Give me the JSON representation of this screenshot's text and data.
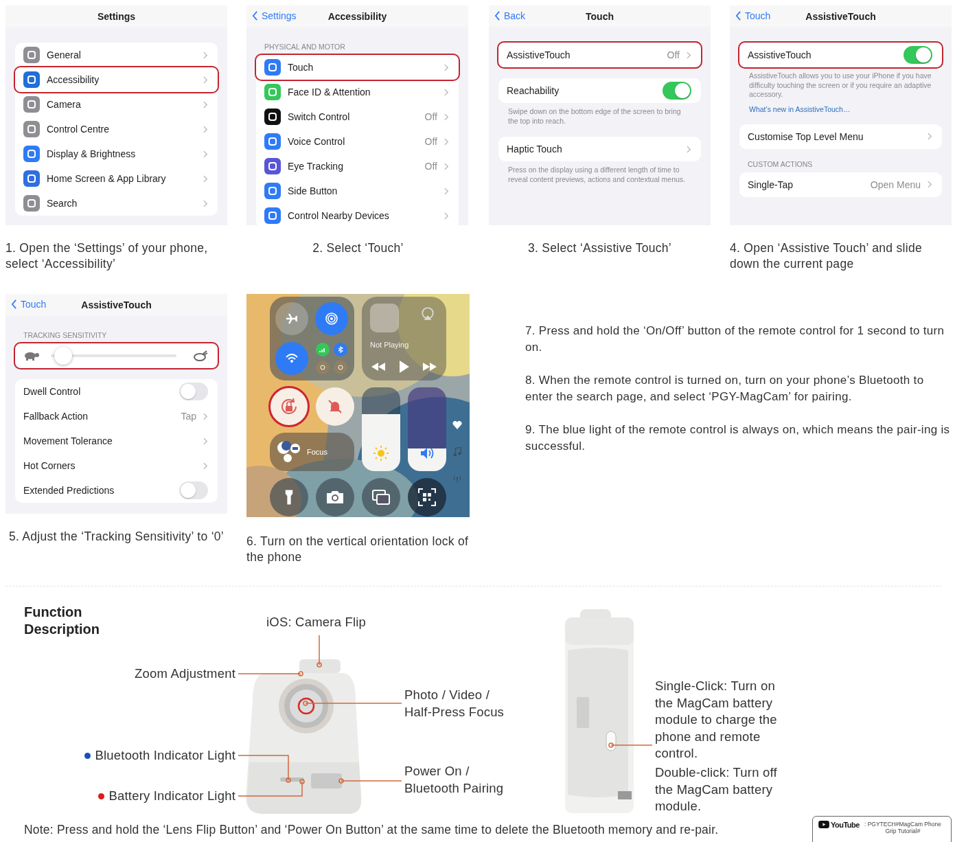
{
  "panels": [
    {
      "title": "Settings",
      "sections": [
        {
          "rows": [
            {
              "kind": "nav",
              "label": "General",
              "color": "#8e8e93",
              "highlighted": false
            },
            {
              "kind": "nav",
              "label": "Accessibility",
              "color": "#1f6fd9",
              "highlighted": true
            },
            {
              "kind": "nav",
              "label": "Camera",
              "color": "#8e8e93",
              "highlighted": false
            },
            {
              "kind": "nav",
              "label": "Control Centre",
              "color": "#8e8e93",
              "highlighted": false
            },
            {
              "kind": "nav",
              "label": "Display & Brightness",
              "color": "#2f7bf6",
              "highlighted": false
            },
            {
              "kind": "nav",
              "label": "Home Screen & App Library",
              "color": "#2f6fe0",
              "highlighted": false
            },
            {
              "kind": "nav",
              "label": "Search",
              "color": "#8e8e93",
              "highlighted": false
            }
          ]
        }
      ],
      "caption": "1. Open the ‘Settings’ of your phone, select ‘Accessibility’"
    },
    {
      "back": "Settings",
      "title": "Accessibility",
      "sections": [
        {
          "header": "PHYSICAL AND MOTOR",
          "rows": [
            {
              "kind": "nav",
              "label": "Touch",
              "color": "#2f7bf6",
              "highlighted": true
            },
            {
              "kind": "nav",
              "label": "Face ID & Attention",
              "color": "#34c759",
              "highlighted": false
            },
            {
              "kind": "nav",
              "label": "Switch Control",
              "value": "Off",
              "color": "#111111",
              "highlighted": false
            },
            {
              "kind": "nav",
              "label": "Voice Control",
              "value": "Off",
              "color": "#2f7bf6",
              "highlighted": false
            },
            {
              "kind": "nav",
              "label": "Eye Tracking",
              "value": "Off",
              "color": "#5856d6",
              "highlighted": false
            },
            {
              "kind": "nav",
              "label": "Side Button",
              "color": "#2f7bf6",
              "highlighted": false
            },
            {
              "kind": "nav",
              "label": "Control Nearby Devices",
              "color": "#2f7bf6",
              "highlighted": false
            }
          ]
        }
      ],
      "caption": "2. Select ‘Touch’"
    },
    {
      "back": "Back",
      "title": "Touch",
      "sections": [
        {
          "rows": [
            {
              "kind": "nav",
              "label": "AssistiveTouch",
              "value": "Off",
              "highlighted": true
            }
          ]
        },
        {
          "rows": [
            {
              "kind": "toggle",
              "label": "Reachability",
              "on": true,
              "highlighted": false
            }
          ],
          "footer": "Swipe down on the bottom edge of the screen to bring the top into reach."
        },
        {
          "rows": [
            {
              "kind": "nav",
              "label": "Haptic Touch",
              "highlighted": false
            }
          ],
          "footer": "Press on the display using a different length of time to reveal content previews, actions and contextual menus."
        }
      ],
      "caption": "3. Select ‘Assistive Touch’"
    },
    {
      "back": "Touch",
      "title": "AssistiveTouch",
      "sections": [
        {
          "rows": [
            {
              "kind": "toggle",
              "label": "AssistiveTouch",
              "on": true,
              "highlighted": true
            }
          ],
          "footer": "AssistiveTouch allows you to use your iPhone if you have difficulty touching the screen or if you require an adaptive accessory.",
          "link": "What’s new in AssistiveTouch…"
        },
        {
          "rows": [
            {
              "kind": "nav",
              "label": "Customise Top Level Menu",
              "highlighted": false
            }
          ]
        },
        {
          "header": "CUSTOM ACTIONS",
          "rows": [
            {
              "kind": "nav",
              "label": "Single-Tap",
              "value": "Open Menu",
              "highlighted": false
            }
          ]
        }
      ],
      "caption": "4. Open ‘Assistive Touch’ and slide down the current page"
    },
    {
      "back": "Touch",
      "title": "AssistiveTouch",
      "sections": [
        {
          "header": "TRACKING SENSITIVITY",
          "rows": [
            {
              "kind": "slider",
              "level": 0.03,
              "highlighted": true
            }
          ]
        },
        {
          "rows": [
            {
              "kind": "toggle",
              "label": "Dwell Control",
              "on": false,
              "highlighted": false
            },
            {
              "kind": "nav",
              "label": "Fallback Action",
              "value": "Tap",
              "highlighted": false
            },
            {
              "kind": "nav",
              "label": "Movement Tolerance",
              "highlighted": false
            },
            {
              "kind": "nav",
              "label": "Hot Corners",
              "highlighted": false
            },
            {
              "kind": "toggle",
              "label": "Extended Predictions",
              "on": false,
              "highlighted": false
            }
          ]
        }
      ],
      "caption": "5. Adjust the ‘Tracking Sensitivity’ to ‘0’"
    }
  ],
  "control_center": {
    "toggles": [
      {
        "on": false
      },
      {
        "on": true
      },
      {
        "on": true
      },
      {
        "on": true
      },
      {
        "on": true
      },
      {
        "on": false
      },
      {
        "on": false
      }
    ],
    "media_status": "Not Playing",
    "orientation_lock": {
      "on": true,
      "highlighted": true
    },
    "mute": {
      "on": true
    },
    "focus": "Focus",
    "brightness": {
      "level": 0.68
    },
    "volume": {
      "level": 0.27
    },
    "caption": "6. Turn on the vertical orientation lock of the phone"
  },
  "steps": [
    "7. Press and hold the ‘On/Off’ button of the remote control for 1 second to turn on.",
    "8. When the remote control is turned on, turn on your phone’s Bluetooth to enter the search page, and select ‘PGY-MagCam’ for pairing.",
    "9. The blue light of the remote control is always on, which means the pair-ing is successful."
  ],
  "function": {
    "title": "Function Description",
    "callouts": [
      {
        "text": "iOS: Camera Flip"
      },
      {
        "text": "Zoom Adjustment"
      },
      {
        "text": "Photo / Video / Half-Press Focus"
      },
      {
        "text": "Bluetooth Indicator Light",
        "color": "#1d4fb8"
      },
      {
        "text": "Battery Indicator Light",
        "color": "#e01b1b"
      },
      {
        "text": "Power On / Bluetooth Pairing"
      },
      {
        "text": "Single-Click: Turn on the MagCam battery module to charge the phone and remote control."
      },
      {
        "text": "Double-click: Turn off the MagCam battery module."
      }
    ],
    "note": "Note: Press and hold the ‘Lens Flip Button’ and ‘Power On Button’ at the same time to delete the Bluetooth memory and re-pair."
  },
  "youtube": {
    "logo": "YouTube",
    "text": ": PGYTECH#MagCam Phone Grip Tutorial#"
  }
}
